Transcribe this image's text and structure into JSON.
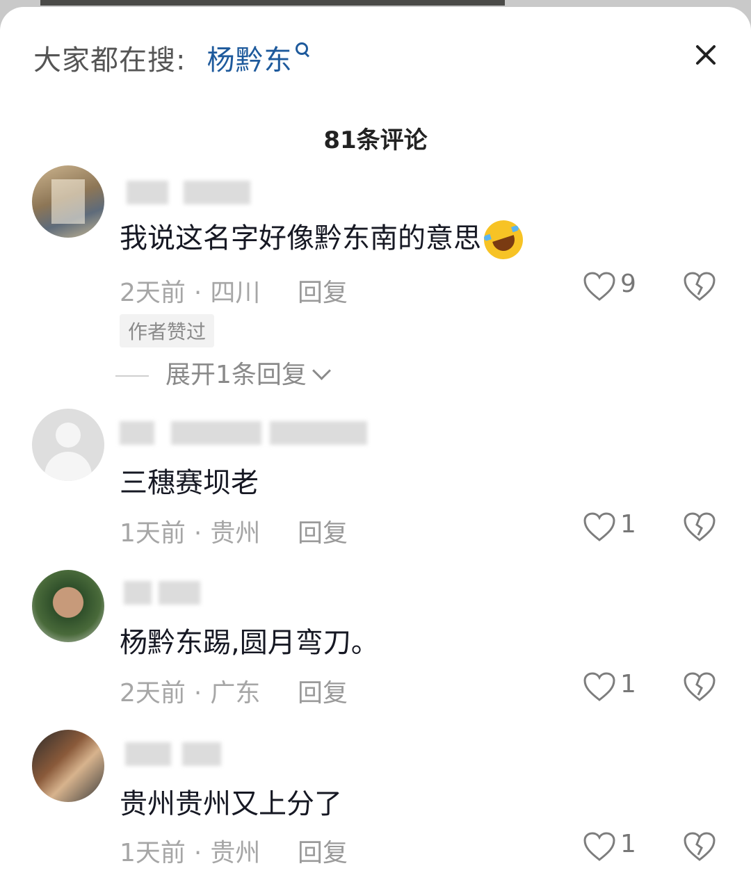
{
  "header": {
    "search_prefix": "大家都在搜:",
    "search_term": "杨黔东"
  },
  "comment_count": "81条评论",
  "comments": [
    {
      "text": "我说这名字好像黔东南的意思",
      "time": "2天前",
      "location": "四川",
      "reply_label": "回复",
      "likes": "9",
      "badge": "作者赞过",
      "expand_label": "展开1条回复"
    },
    {
      "text": "三穗赛坝老",
      "time": "1天前",
      "location": "贵州",
      "reply_label": "回复",
      "likes": "1"
    },
    {
      "text": "杨黔东踢,圆月弯刀。",
      "time": "2天前",
      "location": "广东",
      "reply_label": "回复",
      "likes": "1"
    },
    {
      "text": "贵州贵州又上分了",
      "time": "1天前",
      "location": "贵州",
      "reply_label": "回复",
      "likes": "1"
    }
  ],
  "colors": {
    "accent_link": "#1e5a9c",
    "meta_gray": "#a6a6a6"
  }
}
